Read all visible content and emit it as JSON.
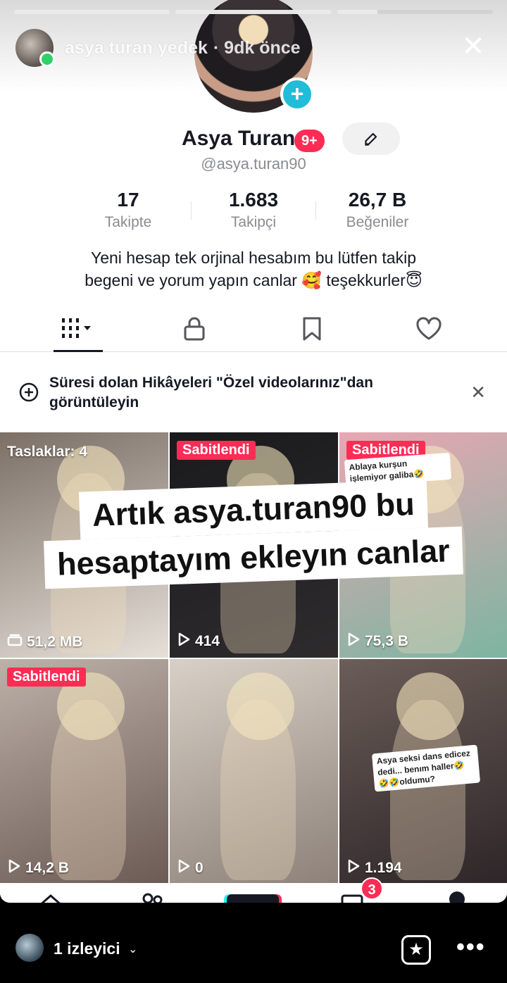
{
  "story": {
    "username": "asya turan yedek",
    "time": "· 9dk önce",
    "progress": [
      1.0,
      1.0,
      0.26
    ]
  },
  "profile": {
    "display_name": "Asya Turan",
    "notification_badge": "9+",
    "handle": "@asya.turan90",
    "stats": [
      {
        "value": "17",
        "label": "Takipte"
      },
      {
        "value": "1.683",
        "label": "Takipçi"
      },
      {
        "value": "26,7 B",
        "label": "Beğeniler"
      }
    ],
    "bio_line1": "Yeni hesap tek orjinal hesabım bu lütfen takip",
    "bio_line2": "begeni ve yorum yapın canlar 🥰 teşekkurler😇"
  },
  "tabs": [
    "videos",
    "private",
    "saved",
    "liked"
  ],
  "notice": {
    "text": "Süresi dolan Hikâyeleri \"Özel videolarınız\"dan görüntüleyin"
  },
  "grid": [
    {
      "top_label": "Taslaklar: 4",
      "type": "draft",
      "stat": "51,2 MB",
      "colors": [
        "#7b6f66",
        "#e6e0d8"
      ]
    },
    {
      "top_label": "Sabitlendi",
      "type": "pinned",
      "stat": "414",
      "colors": [
        "#1a1a1c",
        "#2e2b2d"
      ]
    },
    {
      "top_label": "Sabitlendi",
      "type": "pinned",
      "stat": "75,3 B",
      "colors": [
        "#e8a7b2",
        "#7db5a1"
      ],
      "sticker": "Ablaya kurşun işlemiyor galiba🤣"
    },
    {
      "top_label": "Sabitlendi",
      "type": "pinned",
      "stat": "14,2 B",
      "colors": [
        "#bcb1a8",
        "#6c5a55"
      ]
    },
    {
      "top_label": "",
      "type": "video",
      "stat": "0",
      "colors": [
        "#d8d0c6",
        "#8d8179"
      ]
    },
    {
      "top_label": "",
      "type": "video",
      "stat": "1.194",
      "colors": [
        "#6b5d58",
        "#2d2528"
      ],
      "sticker": "Asya seksi dans edicez dedi... benım haller🤣🤣🤣oldumu?"
    }
  ],
  "overlay": {
    "line1": "Artık asya.turan90 bu",
    "line2": "hesaptayım ekleyın canlar"
  },
  "bottom_nav": {
    "inbox_badge": "3"
  },
  "viewer": {
    "count_label": "1 izleyici"
  }
}
